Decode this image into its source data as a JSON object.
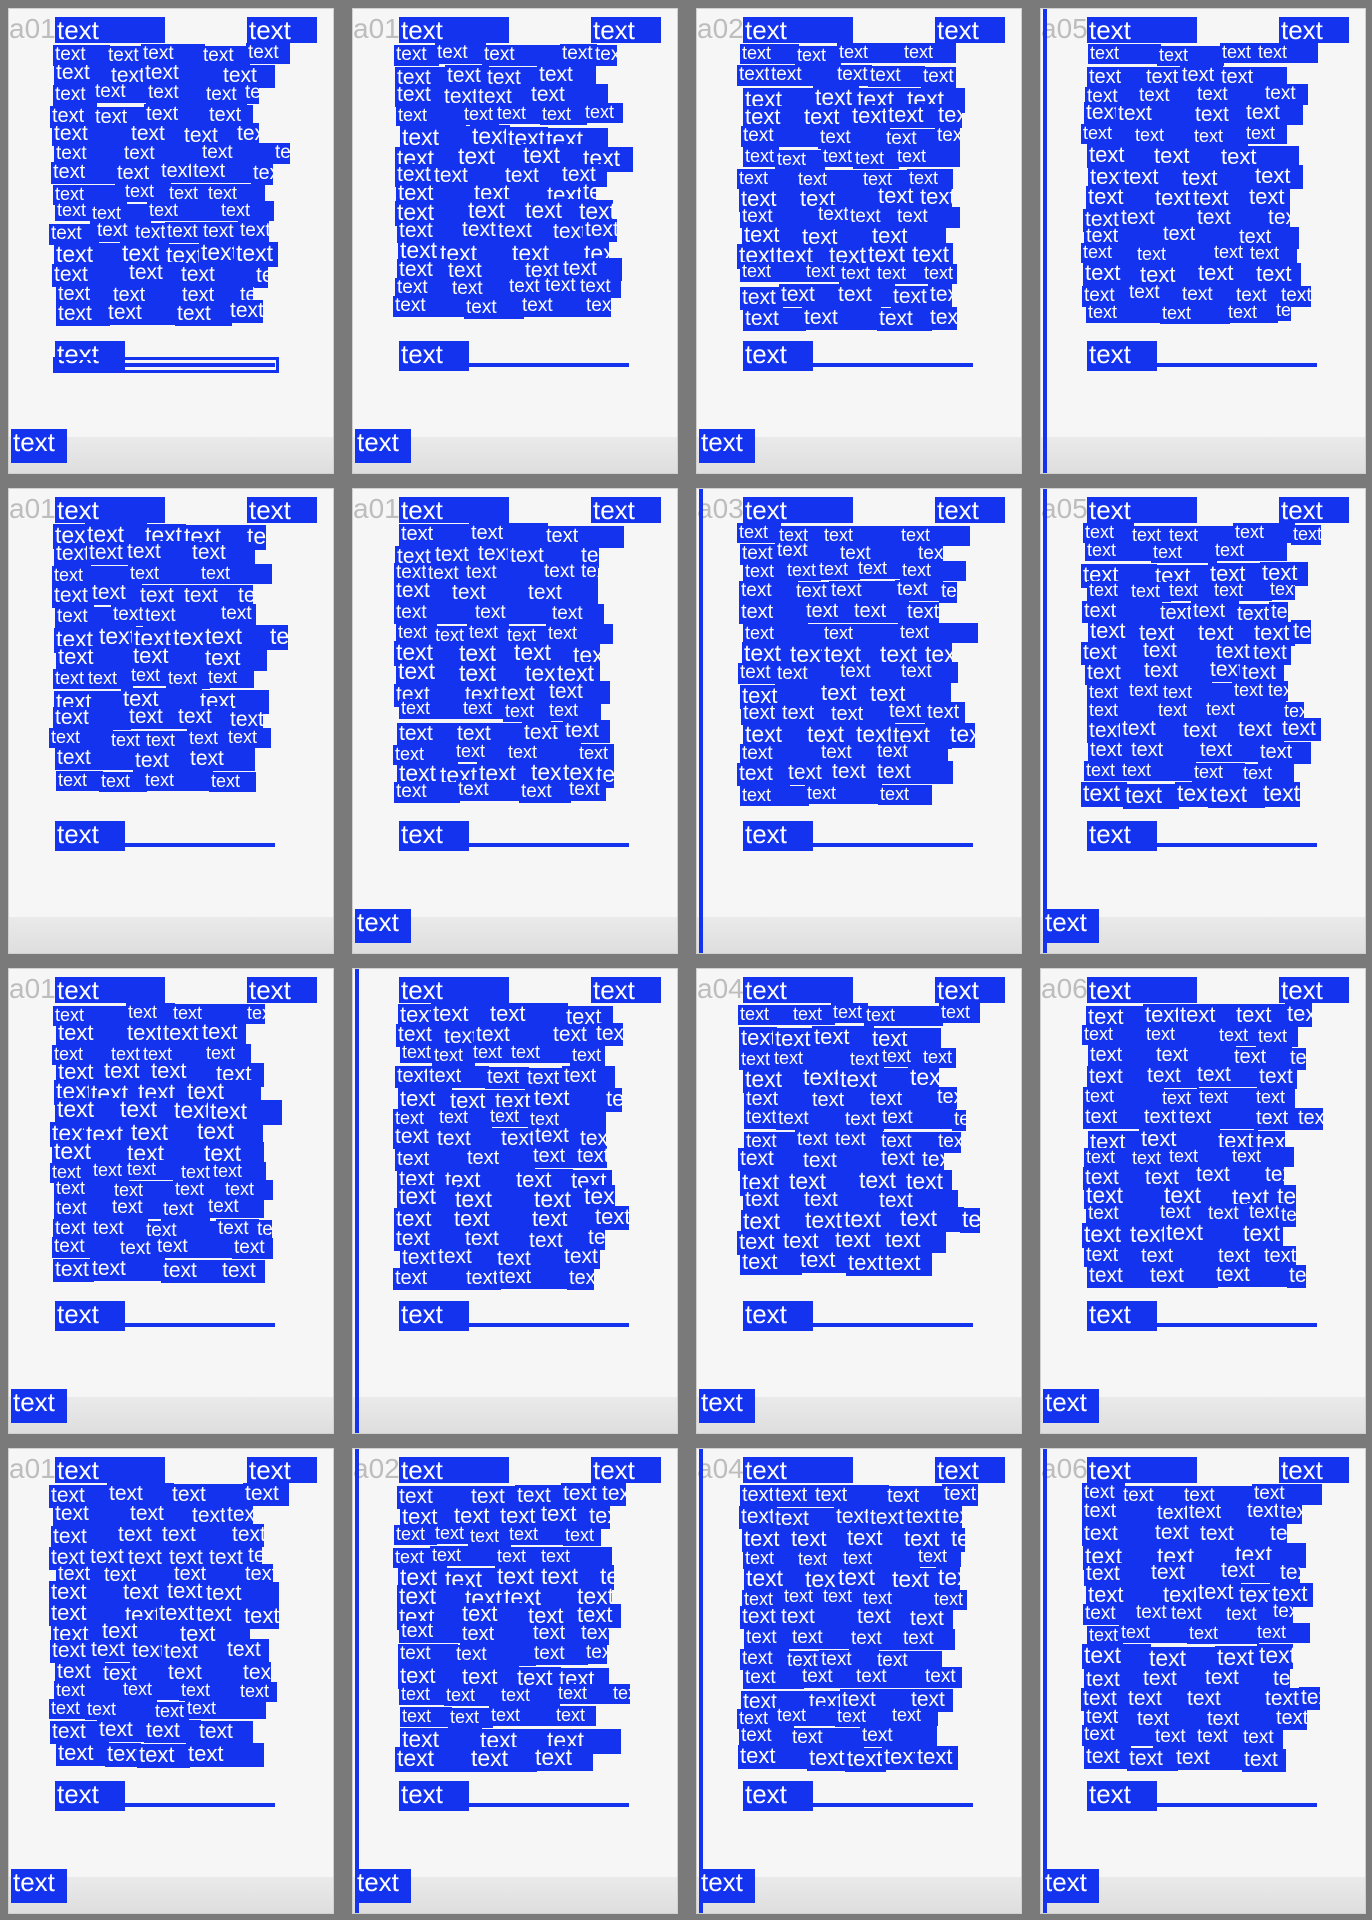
{
  "label": "text",
  "pages": [
    {
      "id": "a01"
    },
    {
      "id": "a01"
    },
    {
      "id": "a02"
    },
    {
      "id": "a05"
    },
    {
      "id": "a01"
    },
    {
      "id": "a01"
    },
    {
      "id": "a03"
    },
    {
      "id": "a05"
    },
    {
      "id": "a01"
    },
    {
      "id": ""
    },
    {
      "id": "a04"
    },
    {
      "id": "a06"
    },
    {
      "id": "a01"
    },
    {
      "id": "a02"
    },
    {
      "id": "a04"
    },
    {
      "id": "a06"
    }
  ],
  "colors": {
    "box": "#1433ee",
    "background": "#7a7a7a",
    "page": "#f6f6f6"
  }
}
